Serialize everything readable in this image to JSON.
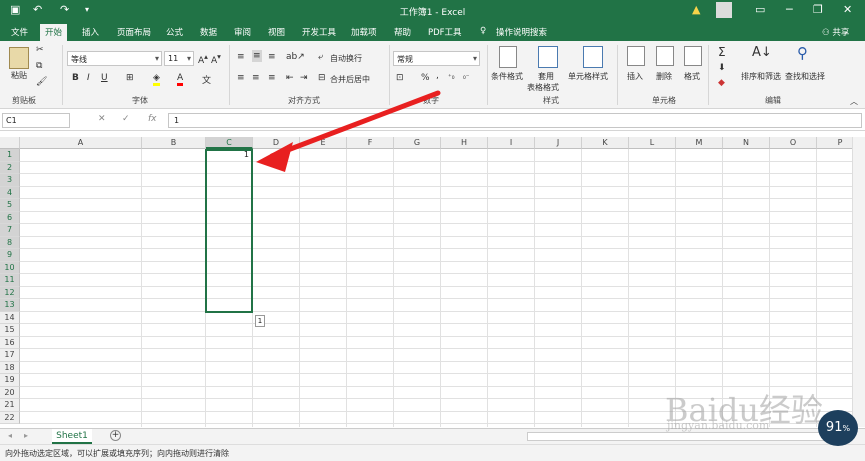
{
  "titlebar": {
    "title": "工作簿1 - Excel",
    "user_initial": "",
    "warning_icon": "warning-icon",
    "window_controls": [
      "─",
      "❐",
      "✕"
    ]
  },
  "menu": {
    "tabs": [
      "文件",
      "开始",
      "插入",
      "页面布局",
      "公式",
      "数据",
      "审阅",
      "视图",
      "开发工具",
      "加载项",
      "帮助",
      "PDF工具"
    ],
    "active_index": 1,
    "tell_me": "操作说明搜索",
    "share": "共享"
  },
  "ribbon": {
    "clipboard": {
      "paste": "粘贴",
      "label": "剪贴板"
    },
    "font": {
      "name": "等线",
      "size": "11",
      "label": "字体",
      "bold": "B",
      "italic": "I",
      "underline": "U"
    },
    "alignment": {
      "wrap": "自动换行",
      "merge": "合并后居中",
      "label": "对齐方式"
    },
    "number": {
      "format": "常规",
      "label": "数字",
      "percent": "%",
      "comma": ","
    },
    "styles": {
      "conditional": "条件格式",
      "table_line1": "套用",
      "table_line2": "表格格式",
      "cell_styles": "单元格样式",
      "label": "样式"
    },
    "cells": {
      "insert": "插入",
      "delete": "删除",
      "format": "格式",
      "label": "单元格"
    },
    "editing": {
      "sort": "排序和筛选",
      "find": "查找和选择",
      "label": "编辑"
    }
  },
  "formula_bar": {
    "name_box": "C1",
    "fx": "fx",
    "value": "1"
  },
  "grid": {
    "columns": [
      "A",
      "B",
      "C",
      "D",
      "E",
      "F",
      "G",
      "H",
      "I",
      "J",
      "K",
      "L",
      "M",
      "N",
      "O",
      "P"
    ],
    "rows": [
      "1",
      "2",
      "3",
      "4",
      "5",
      "6",
      "7",
      "8",
      "9",
      "10",
      "11",
      "12",
      "13",
      "14",
      "15",
      "16",
      "17",
      "18",
      "19",
      "20",
      "21",
      "22"
    ],
    "selected_column": "C",
    "cell_C1": "1",
    "autofill_hint": "1"
  },
  "sheets": {
    "tabs": [
      "Sheet1"
    ],
    "add": "+"
  },
  "status": {
    "text": "向外拖动选定区域，可以扩展或填充序列；向内拖动则进行清除"
  },
  "watermark": {
    "brand": "Baidu经验",
    "url": "jingyan.baidu.com",
    "badge": "91",
    "badge_unit": "%"
  },
  "colors": {
    "accent": "#217346",
    "arrow": "#e82020"
  }
}
